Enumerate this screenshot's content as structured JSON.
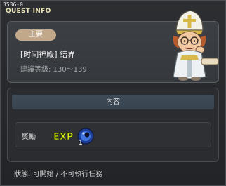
{
  "window": {
    "quest_id": "3536-0",
    "title": "QUEST INFO"
  },
  "quest": {
    "type_label": "主要",
    "name": "[时间神殿] 结界",
    "level_range": "建議等級: 130～139"
  },
  "content": {
    "header": "內容",
    "reward_label": "獎勵",
    "reward_exp_text": "EXP",
    "reward_exp_count": "1"
  },
  "status": {
    "text": "狀態: 可開始 / 不可執行任務"
  },
  "icons": {
    "npc": "npc-pope-icon",
    "exp": "exp-reward-icon"
  },
  "colors": {
    "title": "#e9e1b8",
    "badge": "#c2a88a",
    "header_bar": "#3f4c58",
    "exp_text": "#d9ec1a",
    "exp_orb": "#2446a8"
  }
}
